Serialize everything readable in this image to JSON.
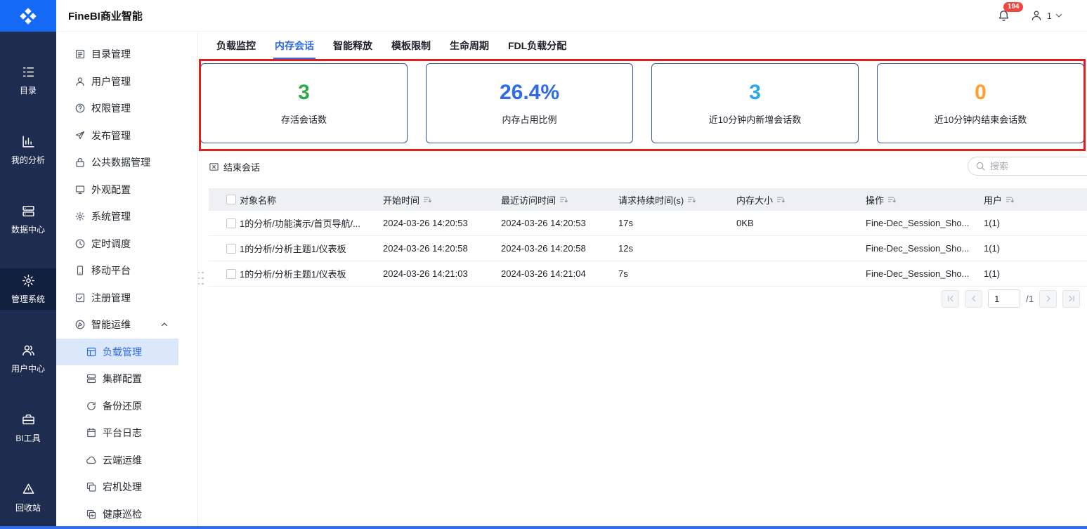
{
  "topbar": {
    "title": "FineBI商业智能",
    "notification_count": "194",
    "user_label": "1"
  },
  "rail": {
    "items": [
      {
        "label": "目录"
      },
      {
        "label": "我的分析"
      },
      {
        "label": "数据中心"
      },
      {
        "label": "管理系统"
      },
      {
        "label": "用户中心"
      },
      {
        "label": "BI工具"
      },
      {
        "label": "回收站"
      }
    ],
    "active": "管理系统"
  },
  "sidebar": {
    "items": [
      {
        "label": "目录管理"
      },
      {
        "label": "用户管理"
      },
      {
        "label": "权限管理"
      },
      {
        "label": "发布管理"
      },
      {
        "label": "公共数据管理"
      },
      {
        "label": "外观配置"
      },
      {
        "label": "系统管理"
      },
      {
        "label": "定时调度"
      },
      {
        "label": "移动平台"
      },
      {
        "label": "注册管理"
      },
      {
        "label": "智能运维"
      }
    ],
    "sub_items": [
      {
        "label": "负载管理"
      },
      {
        "label": "集群配置"
      },
      {
        "label": "备份还原"
      },
      {
        "label": "平台日志"
      },
      {
        "label": "云端运维"
      },
      {
        "label": "宕机处理"
      },
      {
        "label": "健康巡检"
      }
    ],
    "selected": "负载管理"
  },
  "tabs": {
    "items": [
      {
        "label": "负载监控"
      },
      {
        "label": "内存会话"
      },
      {
        "label": "智能释放"
      },
      {
        "label": "模板限制"
      },
      {
        "label": "生命周期"
      },
      {
        "label": "FDL负载分配"
      }
    ],
    "active": "内存会话"
  },
  "cards": [
    {
      "value": "3",
      "label": "存活会话数",
      "color": "#2faa48"
    },
    {
      "value": "26.4%",
      "label": "内存占用比例",
      "color": "#2e6be6"
    },
    {
      "value": "3",
      "label": "近10分钟内新增会话数",
      "color": "#2ba7e8"
    },
    {
      "value": "0",
      "label": "近10分钟内结束会话数",
      "color": "#ff9d2e"
    }
  ],
  "toolbar": {
    "end_session": "结束会话",
    "search_placeholder": "搜索"
  },
  "table": {
    "columns": [
      {
        "label": "对象名称"
      },
      {
        "label": "开始时间"
      },
      {
        "label": "最近访问时间"
      },
      {
        "label": "请求持续时间(s)"
      },
      {
        "label": "内存大小"
      },
      {
        "label": "操作"
      },
      {
        "label": "用户"
      }
    ],
    "rows": [
      {
        "name": "1的分析/功能演示/首页导航/...",
        "start_time": "2024-03-26 14:20:53",
        "last_access": "2024-03-26 14:20:53",
        "duration": "17s",
        "memory": "0KB",
        "operation": "Fine-Dec_Session_Sho...",
        "user": "1(1)"
      },
      {
        "name": "1的分析/分析主题1/仪表板",
        "start_time": "2024-03-26 14:20:58",
        "last_access": "2024-03-26 14:20:58",
        "duration": "12s",
        "memory": "",
        "operation": "Fine-Dec_Session_Sho...",
        "user": "1(1)"
      },
      {
        "name": "1的分析/分析主题1/仪表板",
        "start_time": "2024-03-26 14:21:03",
        "last_access": "2024-03-26 14:21:04",
        "duration": "7s",
        "memory": "",
        "operation": "Fine-Dec_Session_Sho...",
        "user": "1(1)"
      }
    ]
  },
  "pagination": {
    "page": "1",
    "total": "/1"
  },
  "colors": {
    "accent": "#2e6be6",
    "annotation": "#e02020",
    "rail_bg": "#1e2c50",
    "logo_bg": "#1469f5"
  }
}
